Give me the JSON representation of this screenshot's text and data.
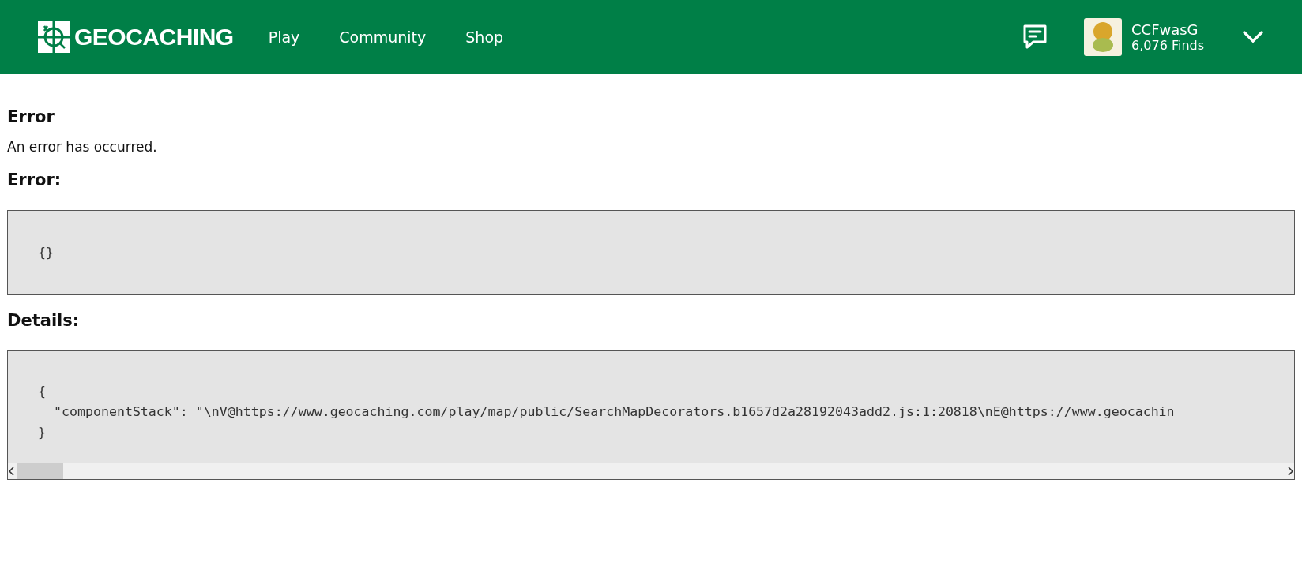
{
  "header": {
    "logo_text": "GEOCACHING",
    "nav": [
      {
        "label": "Play"
      },
      {
        "label": "Community"
      },
      {
        "label": "Shop"
      }
    ],
    "user": {
      "name": "CCFwasG",
      "finds": "6,076 Finds"
    }
  },
  "content": {
    "title": "Error",
    "message": "An error has occurred.",
    "error_label": "Error:",
    "error_lines": [
      "{}"
    ],
    "details_label": "Details:",
    "details_lines": [
      "{",
      "  \"componentStack\": \"\\nV@https://www.geocaching.com/play/map/public/SearchMapDecorators.b1657d2a28192043add2.js:1:20818\\nE@https://www.geocachin",
      "}"
    ]
  }
}
